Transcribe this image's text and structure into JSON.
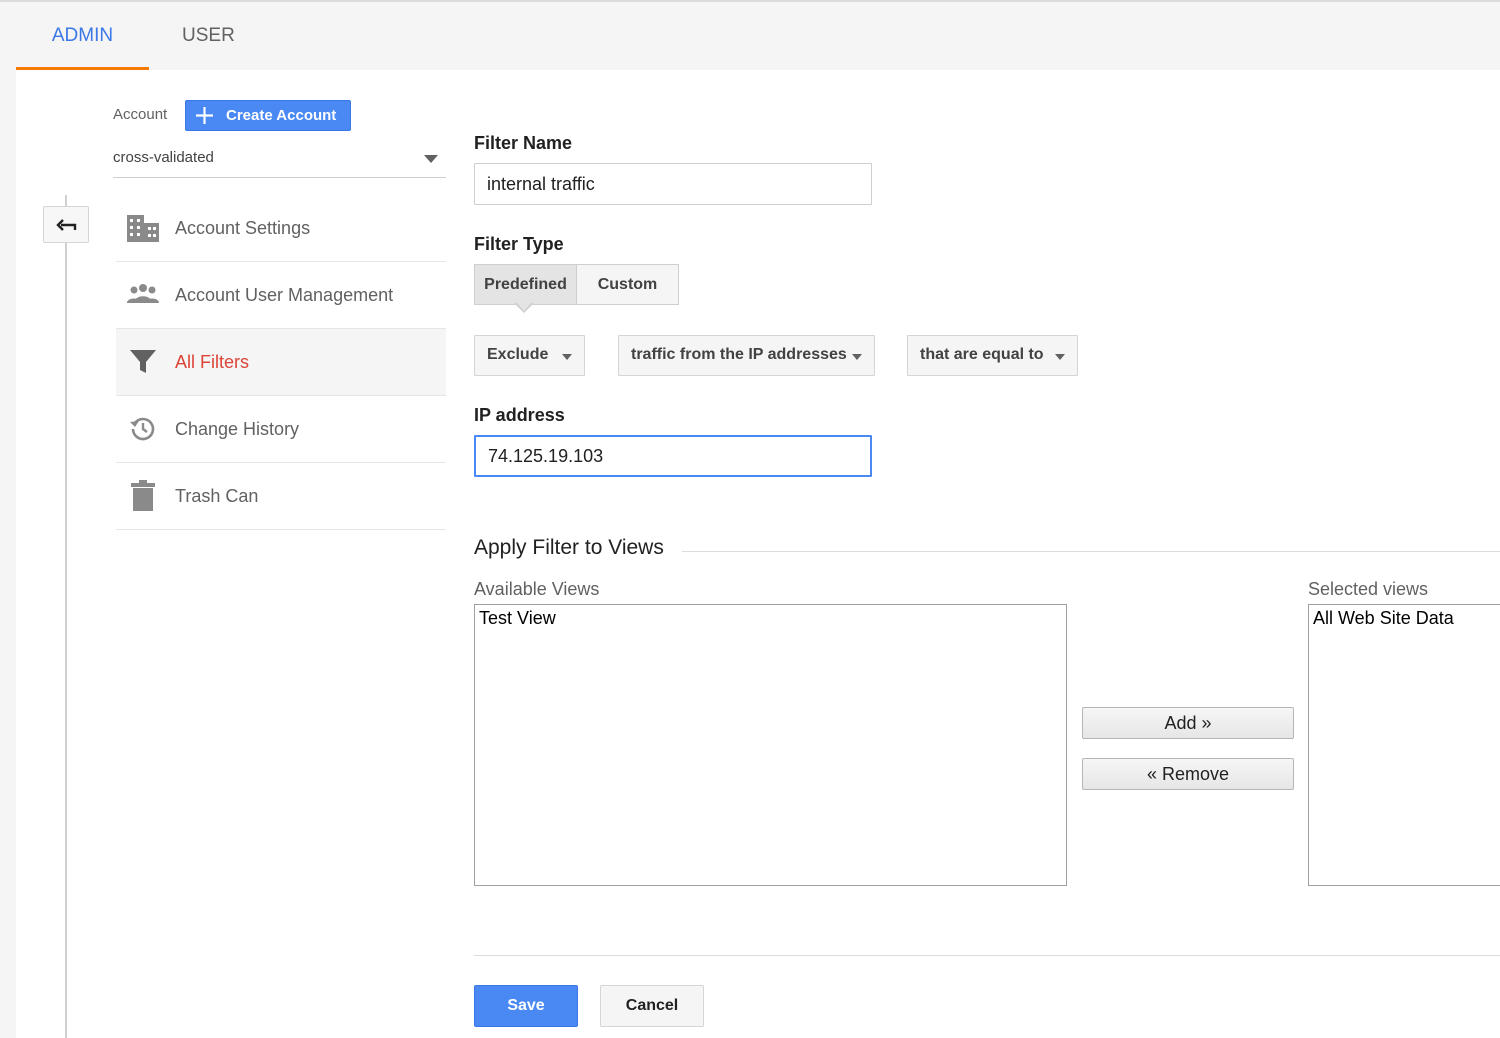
{
  "tabs": [
    {
      "label": "ADMIN",
      "active": true
    },
    {
      "label": "USER",
      "active": false
    }
  ],
  "account": {
    "label": "Account",
    "create_label": "Create Account",
    "selected": "cross-validated"
  },
  "nav": {
    "items": [
      {
        "label": "Account Settings",
        "icon": "building-icon"
      },
      {
        "label": "Account User Management",
        "icon": "people-icon"
      },
      {
        "label": "All Filters",
        "icon": "filter-icon",
        "active": true
      },
      {
        "label": "Change History",
        "icon": "history-icon"
      },
      {
        "label": "Trash Can",
        "icon": "trash-icon"
      }
    ]
  },
  "form": {
    "filter_name_label": "Filter Name",
    "filter_name_value": "internal traffic",
    "filter_type_label": "Filter Type",
    "type_options": [
      "Predefined",
      "Custom"
    ],
    "type_selected": "Predefined",
    "dropdowns": [
      "Exclude",
      "traffic from the IP addresses",
      "that are equal to"
    ],
    "ip_label": "IP address",
    "ip_value": "74.125.19.103"
  },
  "views": {
    "section_title": "Apply Filter to Views",
    "available_label": "Available Views",
    "available": [
      "Test View"
    ],
    "selected_label": "Selected views",
    "selected": [
      "All Web Site Data"
    ],
    "add_label": "Add »",
    "remove_label": "« Remove"
  },
  "actions": {
    "save_label": "Save",
    "cancel_label": "Cancel"
  },
  "colors": {
    "accent_blue": "#4a89f3",
    "active_tab_underline": "#f57c00",
    "active_nav_text": "#db4437"
  }
}
